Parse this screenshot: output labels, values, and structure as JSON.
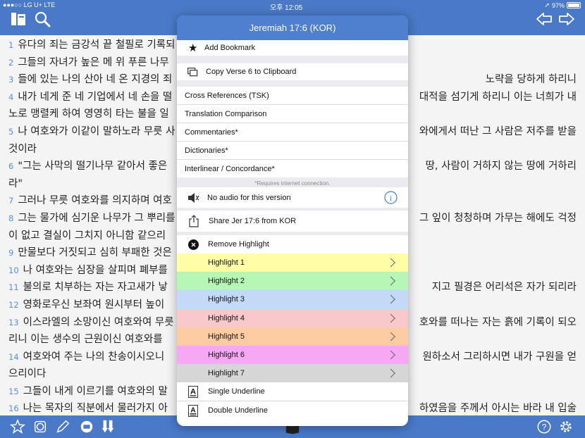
{
  "status": {
    "carrier": "●●●○○ LG U+  LTE",
    "time": "오후 12:05",
    "battery": "97%"
  },
  "popup": {
    "title": "Jeremiah 17:6 (KOR)",
    "add_bookmark": "Add Bookmark",
    "copy_verse": "Copy Verse 6 to Clipboard",
    "cross_refs": "Cross References (TSK)",
    "translation_comparison": "Translation Comparison",
    "commentaries": "Commentaries*",
    "dictionaries": "Dictionaries*",
    "interlinear": "Interlinear / Concordance*",
    "requires_note": "*Requires internet connection.",
    "audio": "No audio for this version",
    "share": "Share Jer 17:6 from KOR",
    "remove_highlight": "Remove Highlight",
    "highlights": [
      {
        "label": "Highlight 1",
        "color": "#ffffa8"
      },
      {
        "label": "Highlight 2",
        "color": "#b7f7b5"
      },
      {
        "label": "Highlight 3",
        "color": "#c4d8f7"
      },
      {
        "label": "Highlight 4",
        "color": "#f9c9c9"
      },
      {
        "label": "Highlight 5",
        "color": "#fccba2"
      },
      {
        "label": "Highlight 6",
        "color": "#f7a8f5"
      },
      {
        "label": "Highlight 7",
        "color": "#d6d6d6"
      }
    ],
    "single_underline": "Single Underline",
    "double_underline": "Double Underline"
  },
  "verses": [
    {
      "n": "1",
      "left": "유다의 죄는 금강석 끝 철필로 기록되",
      "right": ""
    },
    {
      "n": "2",
      "left": "그들의 자녀가 높은 메 위 푸른 나무",
      "right": ""
    },
    {
      "n": "3",
      "left": "들에 있는 나의 산아 네 온 지경의 죄",
      "right": "노략을 당하게 하리니"
    },
    {
      "n": "4",
      "left": "내가 네게 준 네 기업에서 네 손을 떨",
      "right": "대적을 섬기게 하리니 이는 너희가 내"
    },
    {
      "n": "",
      "left": "노로 맹렬케 하여 영영히 타는 불을 일",
      "right": ""
    },
    {
      "n": "5",
      "left": "나 여호와가 이같이 말하노라 무릇 사",
      "right": "와에게서 떠난 그 사람은 저주를 받을"
    },
    {
      "n": "",
      "left": "것이라",
      "right": ""
    },
    {
      "n": "6",
      "left": "\"그는 사막의 떨기나무 같아서 좋은",
      "right": "땅, 사람이 거하지 않는 땅에 거하리"
    },
    {
      "n": "",
      "left": "라\"",
      "right": ""
    },
    {
      "n": "7",
      "left": "그러나 무릇 여호와를 의지하며 여호",
      "right": ""
    },
    {
      "n": "8",
      "left": "그는 물가에 심기운 나무가 그 뿌리를",
      "right": "그 잎이 청청하며 가무는 해에도 걱정"
    },
    {
      "n": "",
      "left": "이 없고 결실이 그치지 아니함 같으리",
      "right": ""
    },
    {
      "n": "9",
      "left": "만물보다 거짓되고 심히 부패한 것은",
      "right": ""
    },
    {
      "n": "10",
      "left": "나 여호와는 심장을 살피며 폐부를",
      "right": ""
    },
    {
      "n": "11",
      "left": "불의로 치부하는 자는 자고새가 낳",
      "right": "지고 필경은 어리석은 자가 되리라"
    },
    {
      "n": "12",
      "left": "영화로우신 보좌여 원시부터 높이",
      "right": ""
    },
    {
      "n": "13",
      "left": "이스라엘의 소망이신 여호와여 무릇",
      "right": "호와를 떠나는 자는 흙에 기록이 되오"
    },
    {
      "n": "",
      "left": "리니 이는 생수의 근원이신 여호와를",
      "right": ""
    },
    {
      "n": "14",
      "left": "여호와여 주는 나의 찬송이시오니",
      "right": "원하소서 그리하시면 내가 구원을 얻"
    },
    {
      "n": "",
      "left": "으리이다",
      "right": ""
    },
    {
      "n": "15",
      "left": "그들이 내게 이르기를 여호와의 말",
      "right": ""
    },
    {
      "n": "16",
      "left": "나는 목자의 직분에서 물러가지 아",
      "right": "하였음을 주께서 아시는 바라 내 입술"
    }
  ]
}
